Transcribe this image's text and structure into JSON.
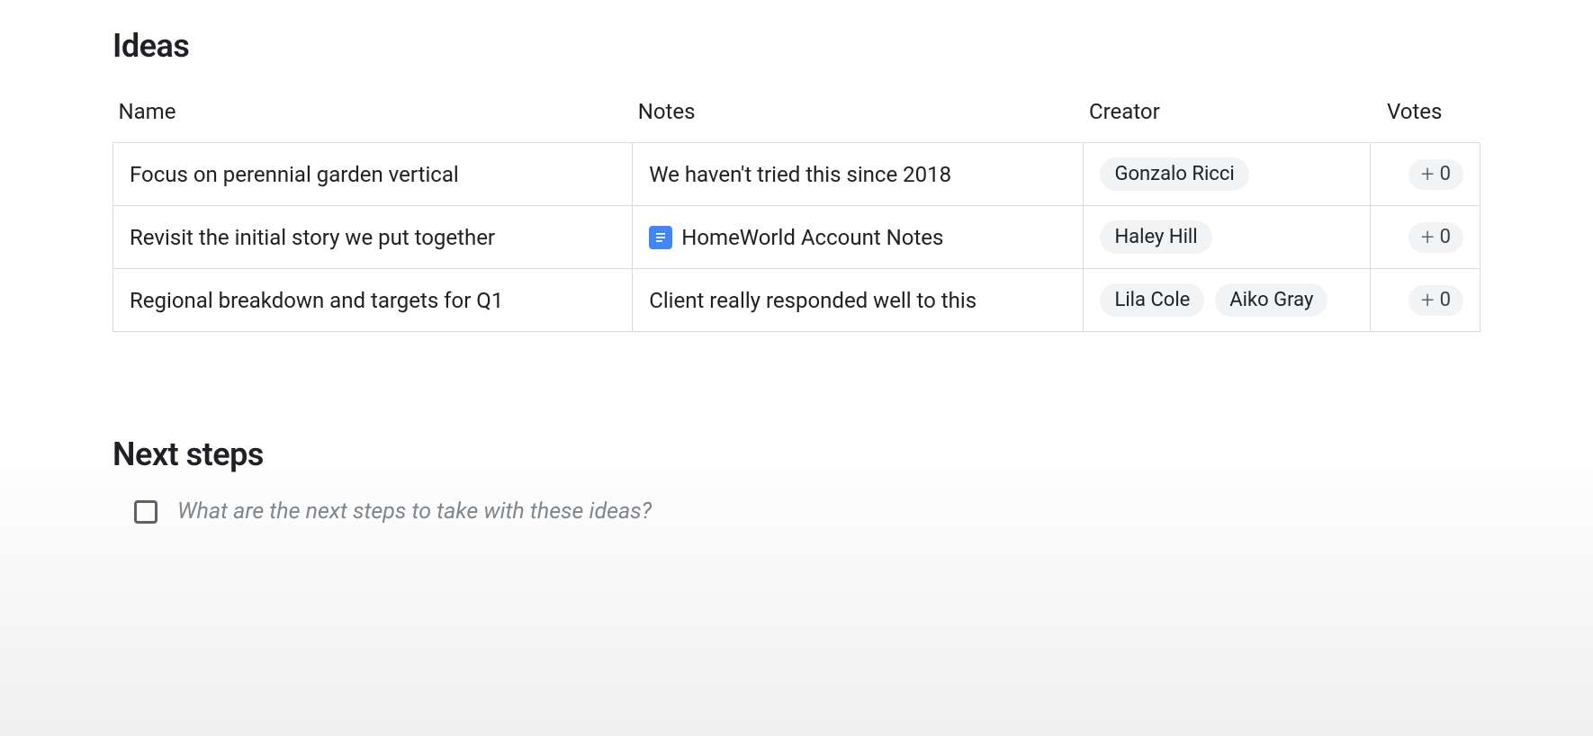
{
  "ideas": {
    "title": "Ideas",
    "columns": {
      "name": "Name",
      "notes": "Notes",
      "creator": "Creator",
      "votes": "Votes"
    },
    "rows": [
      {
        "name": "Focus on perennial garden vertical",
        "notes_text": "We haven't tried this since 2018",
        "notes_type": "text",
        "creators": [
          "Gonzalo Ricci"
        ],
        "votes": "0"
      },
      {
        "name": "Revisit the initial story we put together",
        "notes_text": "HomeWorld Account Notes",
        "notes_type": "doc",
        "creators": [
          "Haley Hill"
        ],
        "votes": "0"
      },
      {
        "name": "Regional breakdown and targets for Q1",
        "notes_text": "Client really responded well to this",
        "notes_type": "text",
        "creators": [
          "Lila Cole",
          "Aiko Gray"
        ],
        "votes": "0"
      }
    ]
  },
  "next_steps": {
    "title": "Next steps",
    "placeholder": "What are the next steps to take with these ideas?"
  }
}
